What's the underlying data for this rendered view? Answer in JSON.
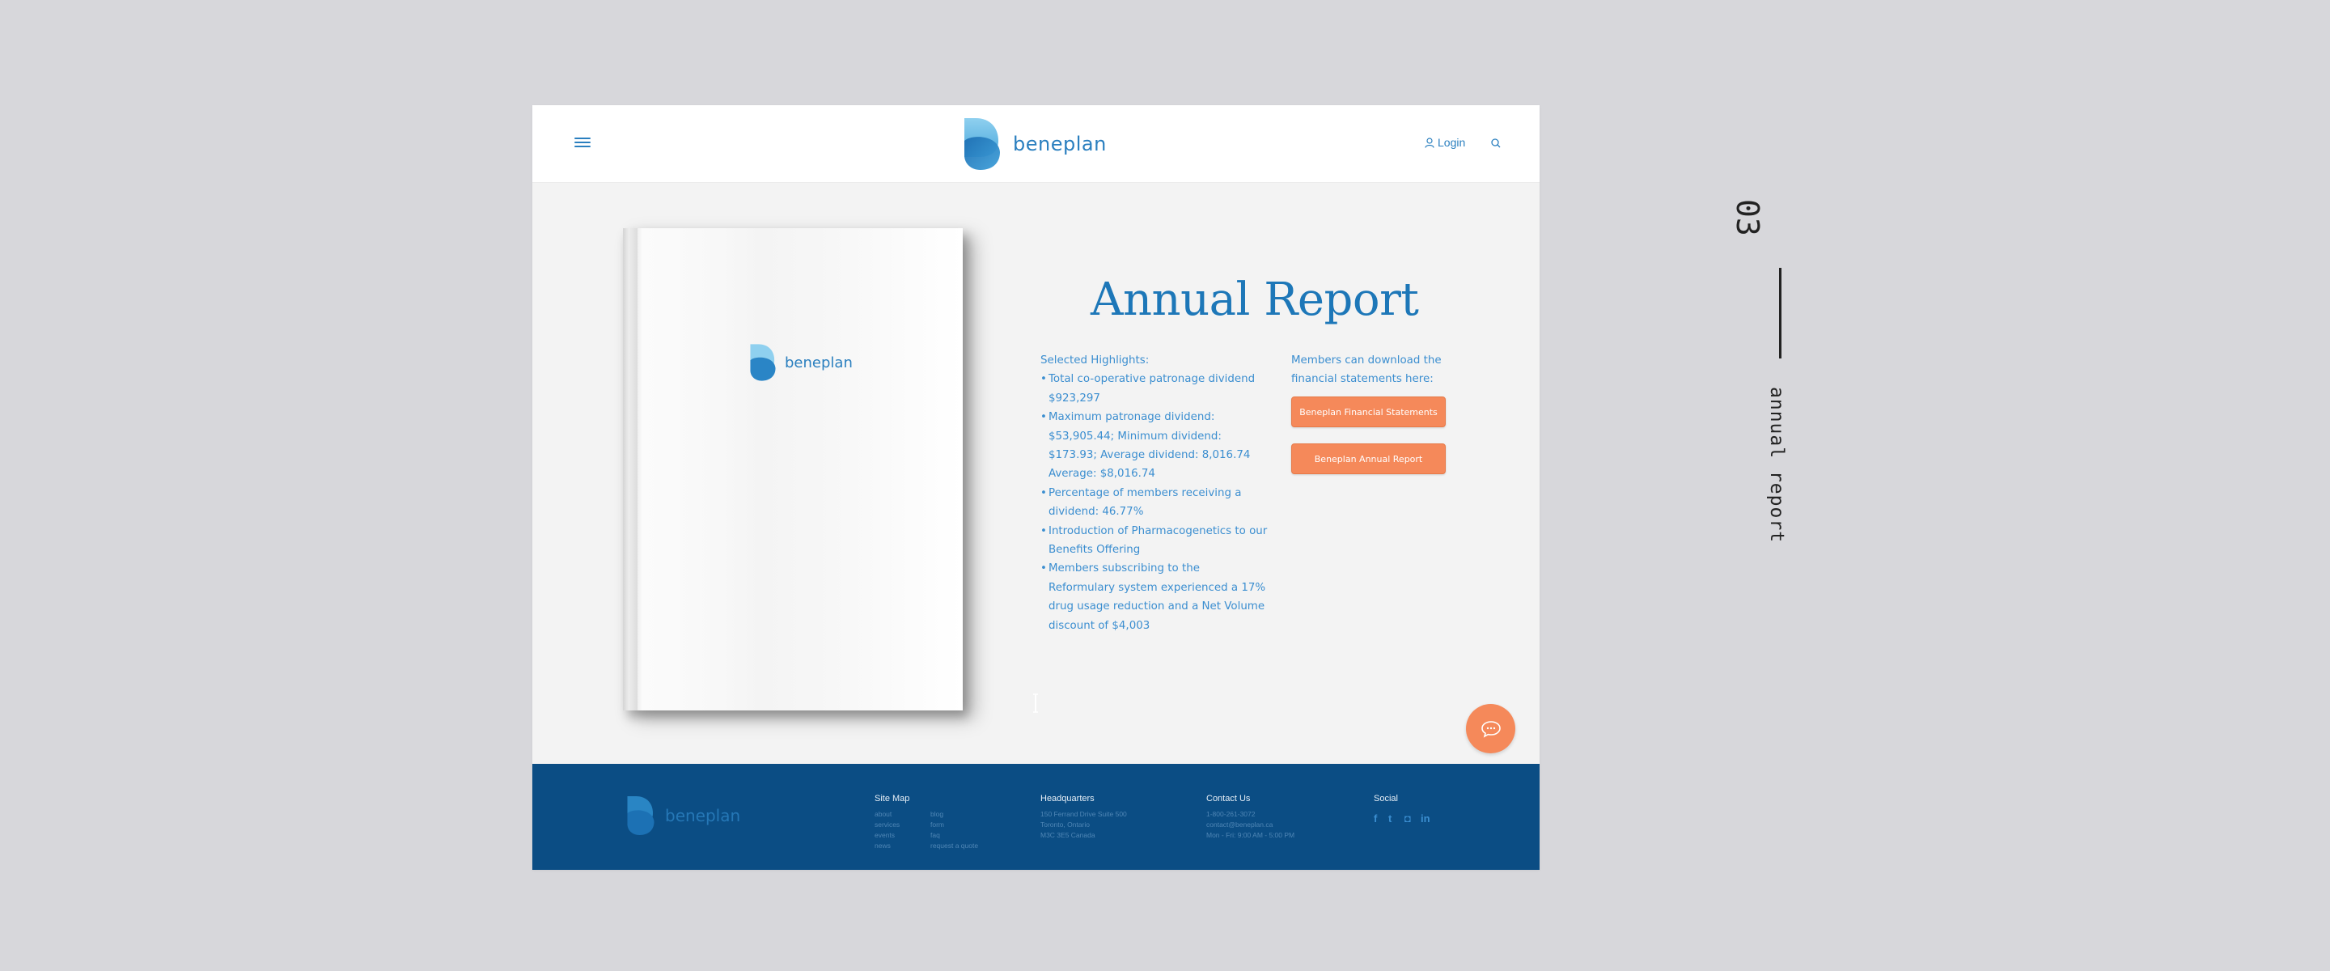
{
  "brand": {
    "name": "beneplan",
    "primary_color": "#2a7fbf",
    "accent_color": "#f5895a",
    "footer_color": "#0b4d84"
  },
  "header": {
    "menu_icon": "hamburger-menu-icon",
    "login_label": "Login",
    "login_icon": "user-icon",
    "search_icon": "search-icon"
  },
  "book_cover": {
    "logo_text": "beneplan"
  },
  "main": {
    "title": "Annual Report",
    "highlights_heading": "Selected Highlights:",
    "highlights": [
      "Total co-operative patronage dividend $923,297",
      "Maximum patronage dividend: $53,905.44; Minimum dividend: $173.93; Average dividend: 8,016.74 Average: $8,016.74",
      "Percentage of members receiving a dividend: 46.77%",
      "Introduction of Pharmacogenetics to our Benefits Offering",
      "Members subscribing to the Reformulary system experienced a 17% drug usage reduction and a Net Volume discount of $4,003"
    ],
    "download_text": "Members can download the financial statements here:",
    "button_financial": "Beneplan Financial Statements",
    "button_annual": "Beneplan Annual Report"
  },
  "chat": {
    "icon": "chat-bubble-icon"
  },
  "footer": {
    "logo_text": "beneplan",
    "sitemap": {
      "heading": "Site Map",
      "col1": [
        "about",
        "services",
        "events",
        "news"
      ],
      "col2": [
        "blog",
        "form",
        "faq",
        "request a quote"
      ]
    },
    "headquarters": {
      "heading": "Headquarters",
      "lines": [
        "150 Ferrand Drive Suite 500",
        "Toronto, Ontario",
        "M3C 3E5 Canada"
      ]
    },
    "contact": {
      "heading": "Contact Us",
      "lines": [
        "1-800-261-3072",
        "contact@beneplan.ca",
        "Mon - Fri: 9:00 AM - 5:00 PM"
      ]
    },
    "social": {
      "heading": "Social",
      "icons": [
        "facebook-icon",
        "twitter-icon",
        "instagram-icon",
        "linkedin-icon"
      ],
      "glyphs": [
        "f",
        "t",
        "◘",
        "in"
      ]
    }
  },
  "side_annotation": {
    "number": "03",
    "caption": "annual report"
  }
}
